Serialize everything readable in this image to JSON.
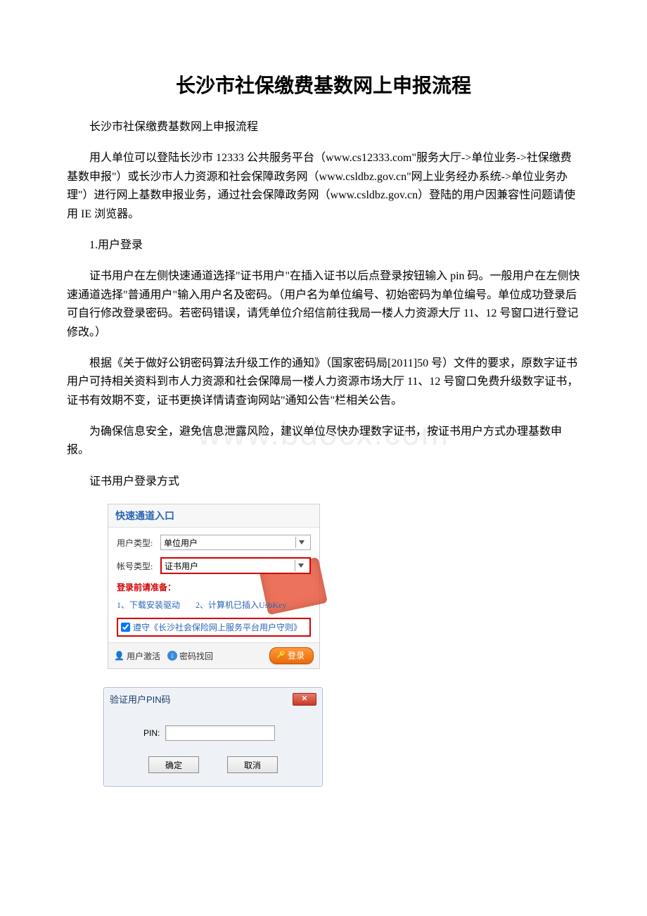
{
  "title": "长沙市社保缴费基数网上申报流程",
  "paragraphs": {
    "p1": "长沙市社保缴费基数网上申报流程",
    "p2": "用人单位可以登陆长沙市 12333 公共服务平台（www.cs12333.com\"服务大厅->单位业务->社保缴费基数申报\"）或长沙市人力资源和社会保障政务网（www.csldbz.gov.cn\"网上业务经办系统->单位业务办理\"）进行网上基数申报业务，通过社会保障政务网（www.csldbz.gov.cn）登陆的用户因兼容性问题请使用 IE 浏览器。",
    "p3": "1.用户登录",
    "p4": "证书用户在左侧快速通道选择\"证书用户\"在插入证书以后点登录按钮输入 pin 码。一般用户在左侧快速通道选择\"普通用户\"输入用户名及密码。（用户名为单位编号、初始密码为单位编号。单位成功登录后可自行修改登录密码。若密码错误，请凭单位介绍信前往我局一楼人力资源大厅 11、12 号窗口进行登记修改。）",
    "p5": "根据《关于做好公钥密码算法升级工作的通知》（国家密码局[2011]50 号）文件的要求，原数字证书用户可持相关资料到市人力资源和社会保障局一楼人力资源市场大厅 11、12 号窗口免费升级数字证书，证书有效期不变，证书更换详情请查询网站\"通知公告\"栏相关公告。",
    "p6": "为确保信息安全，避免信息泄露风险，建议单位尽快办理数字证书，按证书用户方式办理基数申报。",
    "p7": "证书用户登录方式"
  },
  "watermark": "www.bdocx.com",
  "login": {
    "header": "快速通道入口",
    "user_type_label": "用户类型:",
    "user_type_value": "单位用户",
    "acct_type_label": "帐号类型:",
    "acct_type_value": "证书用户",
    "prep_title": "登录前请准备：",
    "prep_item1": "1、下载安装驱动",
    "prep_item2": "2、计算机已插入UsbKey",
    "agree_label": "遵守《长沙社会保险网上服务平台用户守则》",
    "activate": "用户激活",
    "pwd_recover": "密码找回",
    "login_btn": "登录"
  },
  "pin": {
    "title": "验证用户PIN码",
    "label": "PIN:",
    "ok": "确定",
    "cancel": "取消"
  }
}
